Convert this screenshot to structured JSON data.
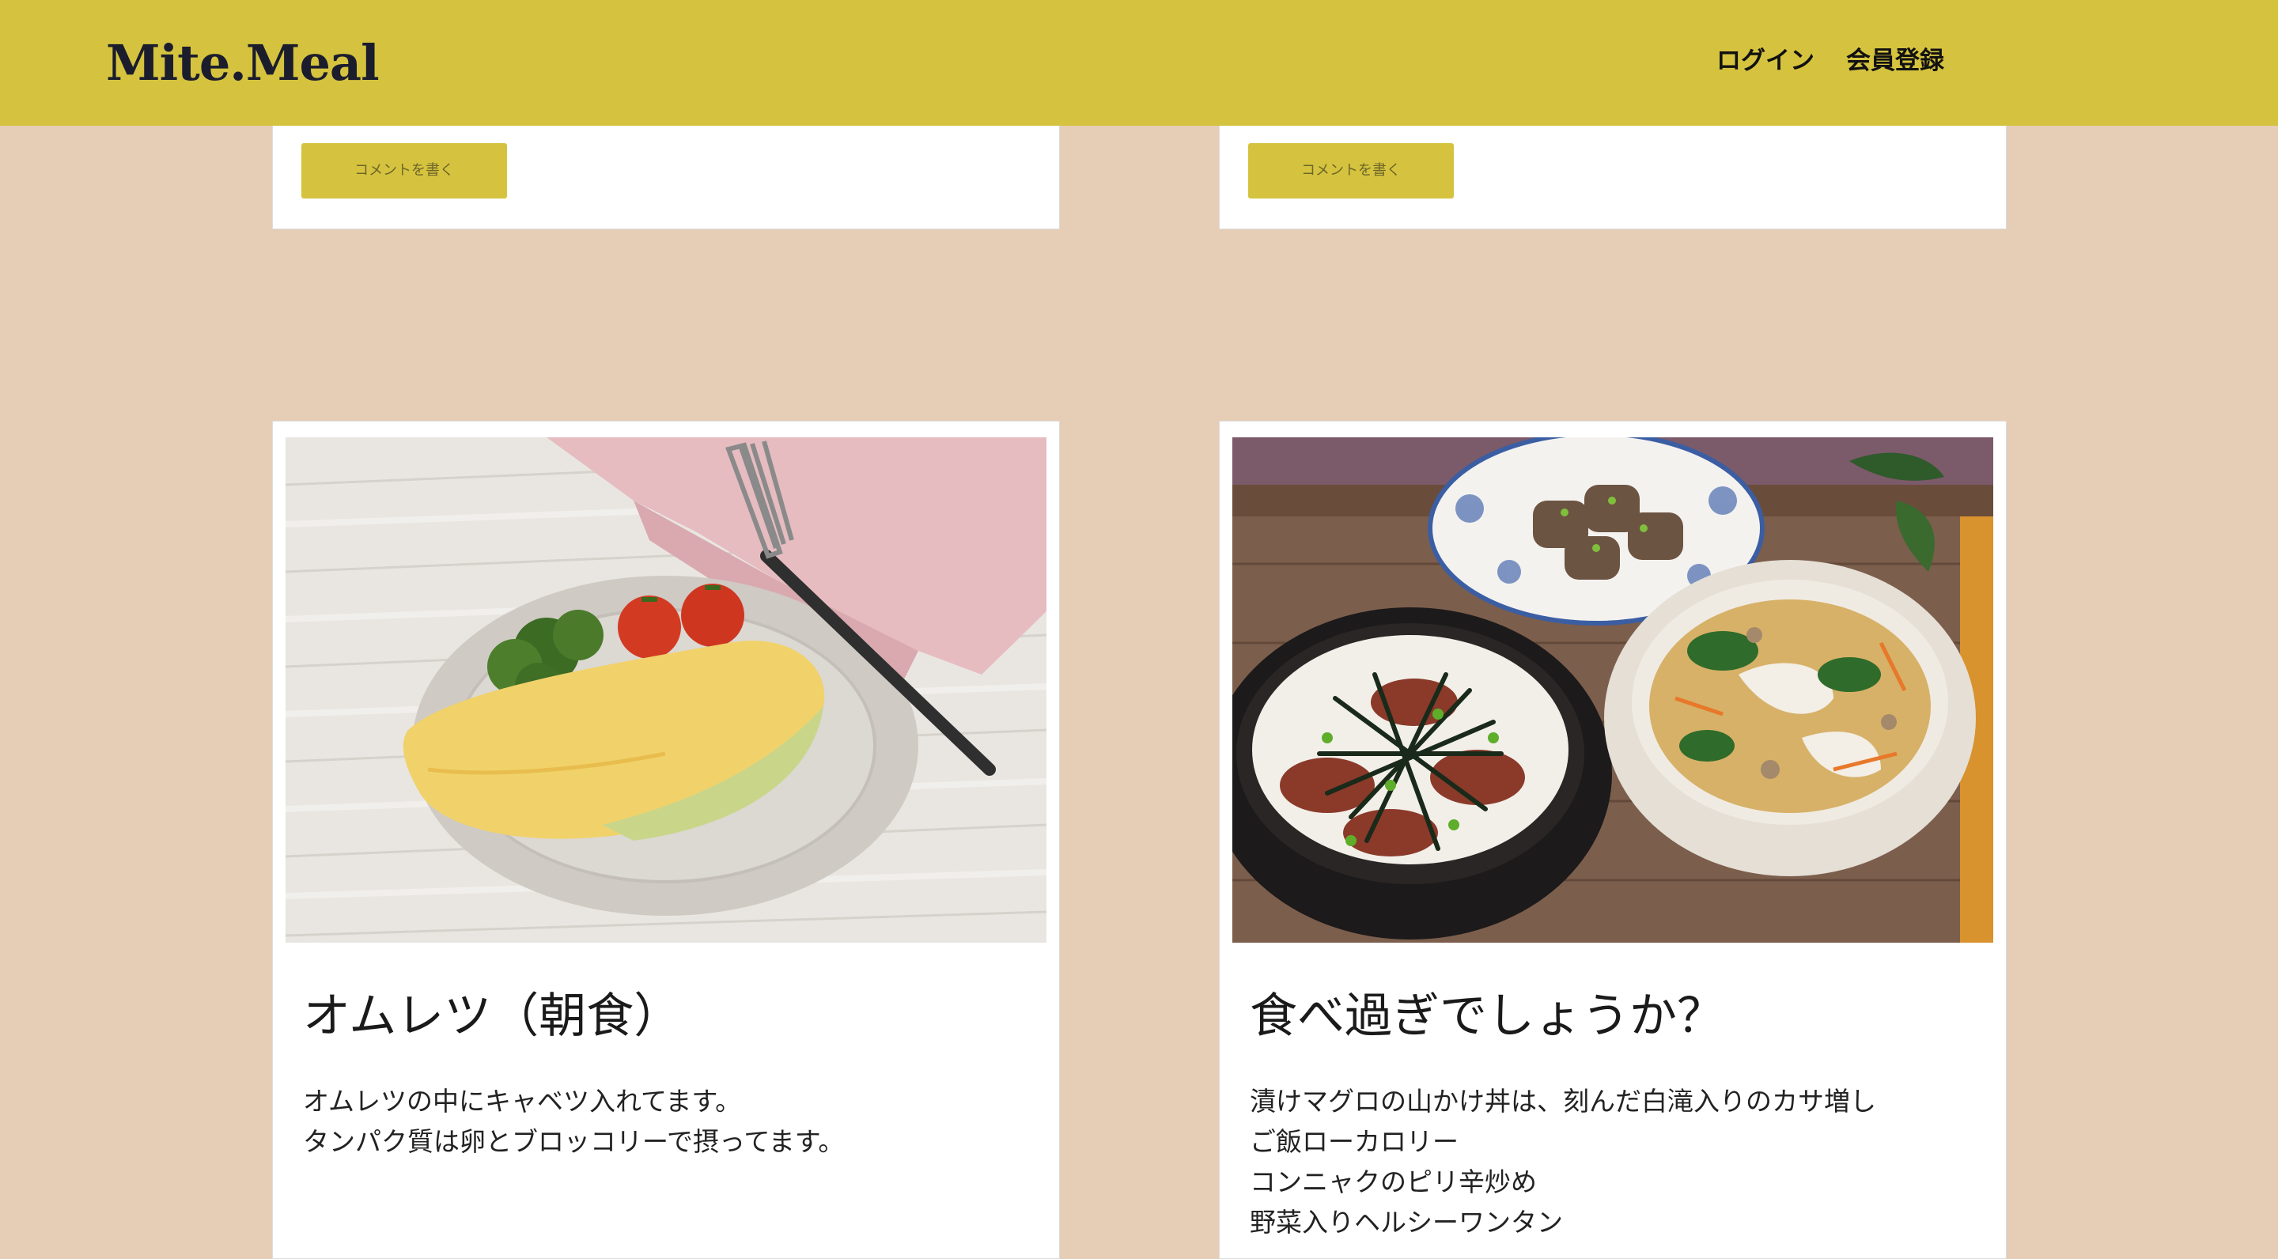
{
  "header": {
    "logo": "Mite.Meal",
    "nav": {
      "login": "ログイン",
      "signup": "会員登録"
    },
    "bg_color": "#d5c33f"
  },
  "page": {
    "bg_color": "#e6cdb6"
  },
  "top_cards": [
    {
      "comment_button": "コメントを書く"
    },
    {
      "comment_button": "コメントを書く"
    }
  ],
  "posts": [
    {
      "photo_icon": "omelette-photo",
      "title": "オムレツ（朝食）",
      "body": [
        "オムレツの中にキャベツ入れてます。",
        "タンパク質は卵とブロッコリーで摂ってます。"
      ]
    },
    {
      "photo_icon": "donburi-soup-photo",
      "title": "食べ過ぎでしょうか？",
      "body": [
        "漬けマグロの山かけ丼は、刻んだ白滝入りのカサ増し",
        "ご飯ローカロリー",
        "コンニャクのピリ辛炒め",
        "野菜入りヘルシーワンタン"
      ]
    }
  ]
}
